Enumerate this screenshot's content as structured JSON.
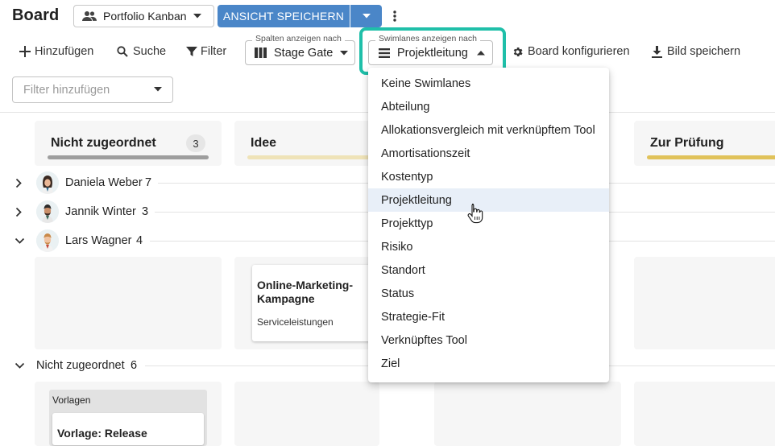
{
  "header": {
    "title": "Board",
    "view_select": "Portfolio Kanban",
    "save_button": "ANSICHT SPEICHERN"
  },
  "toolbar": {
    "add": "Hinzufügen",
    "search": "Suche",
    "filter": "Filter",
    "columns_legend": "Spalten anzeigen nach",
    "columns_value": "Stage Gate",
    "swimlanes_legend": "Swimlanes anzeigen nach",
    "swimlanes_value": "Projektleitung",
    "configure": "Board konfigurieren",
    "save_image": "Bild speichern"
  },
  "filter": {
    "placeholder": "Filter hinzufügen"
  },
  "columns": [
    {
      "title": "Nicht zugeordnet",
      "count": "3",
      "color": "#9e9e9e"
    },
    {
      "title": "Idee",
      "color": "#efe3b8"
    },
    {
      "title": "Zur Prüfung",
      "color": "#e0c25a"
    }
  ],
  "lanes": [
    {
      "name": "Daniela Weber",
      "count": "7",
      "expanded": false
    },
    {
      "name": "Jannik Winter",
      "count": "3",
      "expanded": false
    },
    {
      "name": "Lars Wagner",
      "count": "4",
      "expanded": true
    },
    {
      "name": "Nicht zugeordnet",
      "count": "6",
      "expanded": true
    }
  ],
  "card": {
    "title": "Online-Marketing-Kampagne",
    "subtitle": "Serviceleistungen"
  },
  "template": {
    "label": "Vorlagen",
    "title": "Vorlage: Release"
  },
  "menu": {
    "items": [
      "Keine Swimlanes",
      "Abteilung",
      "Allokationsvergleich mit verknüpftem Tool",
      "Amortisationszeit",
      "Kostentyp",
      "Projektleitung",
      "Projekttyp",
      "Risiko",
      "Standort",
      "Status",
      "Strategie-Fit",
      "Verknüpftes Tool",
      "Ziel"
    ],
    "selected": "Projektleitung"
  },
  "colors": {
    "accent": "#4a86c8",
    "highlight": "#1fbfa9"
  }
}
